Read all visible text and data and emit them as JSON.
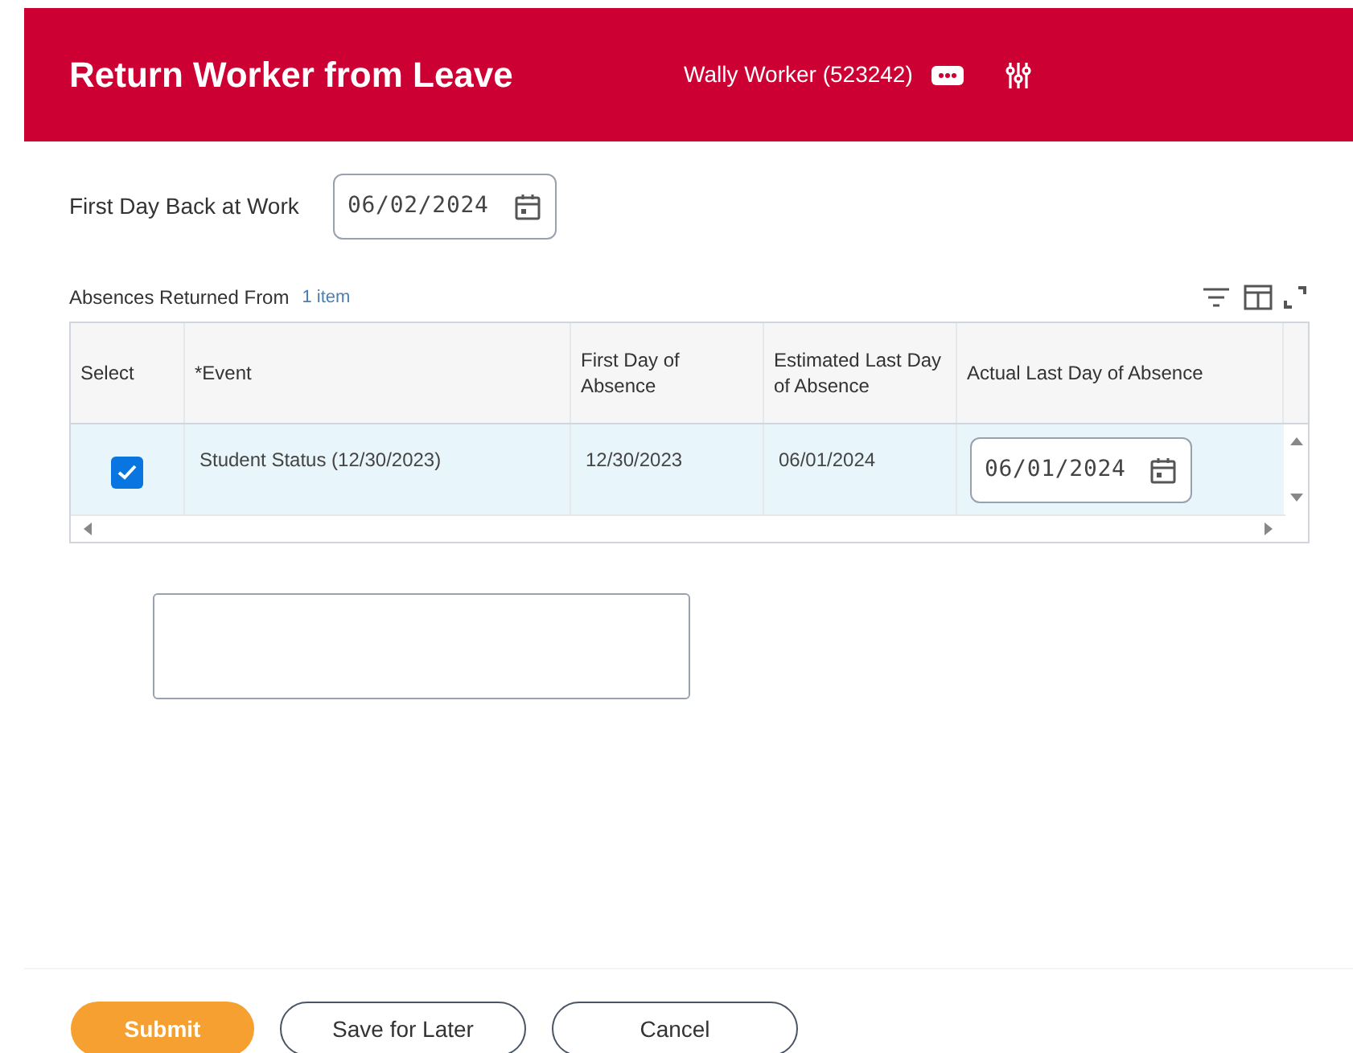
{
  "header": {
    "title": "Return Worker from Leave",
    "worker": "Wally Worker (523242)"
  },
  "first_day_field": {
    "label": "First Day Back at Work",
    "value": "06/02/2024"
  },
  "table": {
    "title": "Absences Returned From",
    "count": "1 item",
    "columns": [
      "Select",
      "*Event",
      "First Day of Absence",
      "Estimated Last Day of Absence",
      "Actual Last Day of Absence"
    ],
    "rows": [
      {
        "checked": true,
        "selected": true,
        "event": "Student Status (12/30/2023)",
        "first_day": "12/30/2023",
        "estimated_last_day": "06/01/2024",
        "actual_last_day": "06/01/2024"
      }
    ]
  },
  "buttons": [
    {
      "label": "Submit",
      "kind": "primary"
    },
    {
      "label": "Save for Later",
      "kind": "secondary"
    },
    {
      "label": "Cancel",
      "kind": "secondary"
    }
  ]
}
